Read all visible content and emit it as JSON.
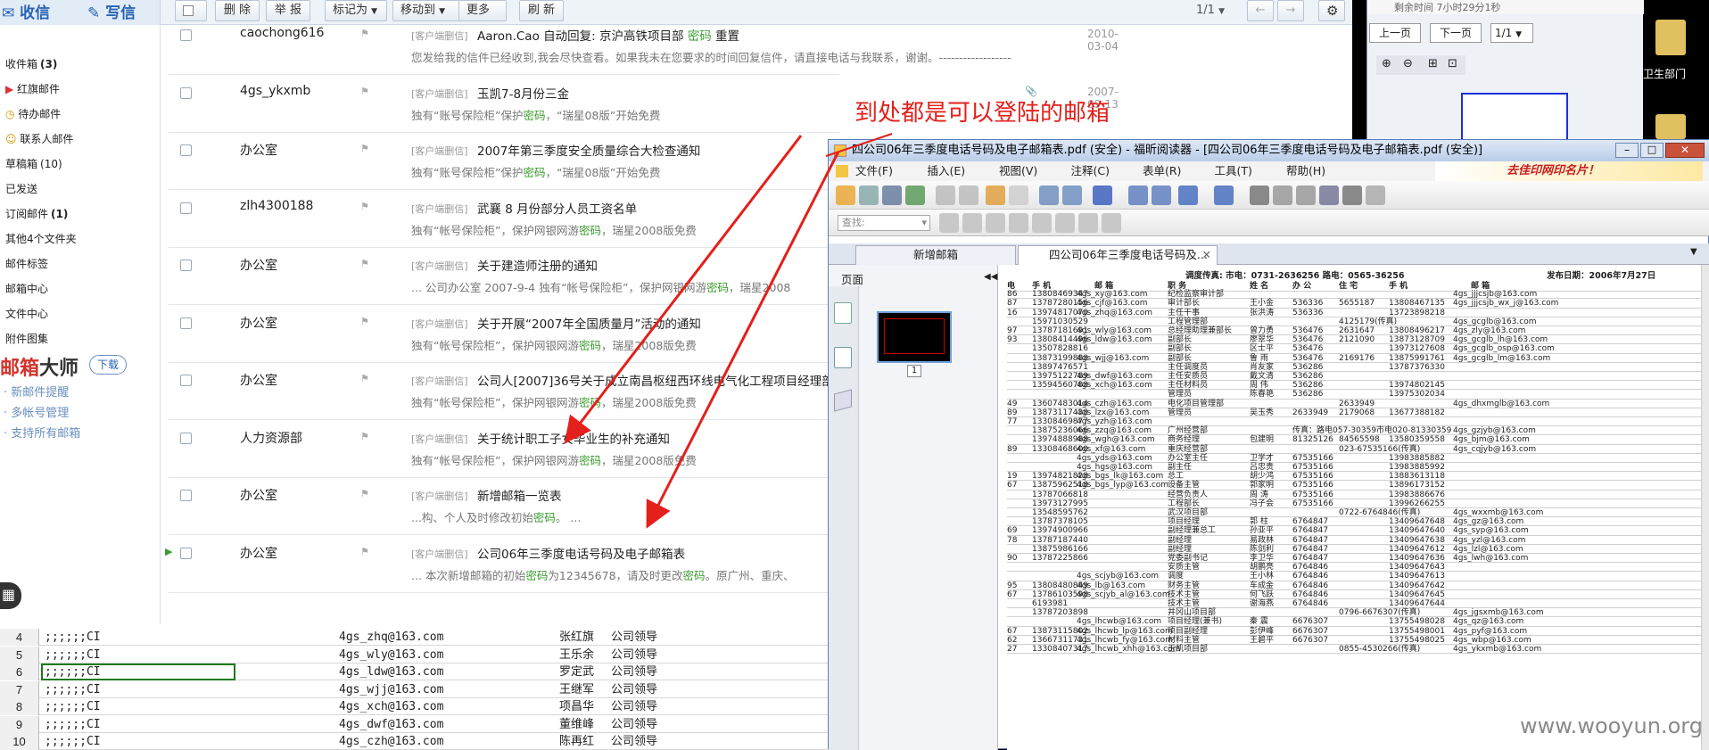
{
  "mail": {
    "top_buttons": {
      "inbox": "收信",
      "compose": "写信",
      "delete": "删 除",
      "report": "举 报",
      "mark": "标记为",
      "move": "移动到",
      "more": "更多",
      "refresh": "刷 新",
      "page": "1/1"
    },
    "sidebar": [
      {
        "label": "收件箱",
        "count": "(3)"
      },
      {
        "label": "红旗邮件",
        "count": ""
      },
      {
        "label": "待办邮件",
        "count": ""
      },
      {
        "label": "联系人邮件",
        "count": ""
      },
      {
        "label": "草稿箱",
        "count": "(10)"
      },
      {
        "label": "已发送",
        "count": ""
      },
      {
        "label": "订阅邮件",
        "count": "(1)"
      },
      {
        "label": "其他4个文件夹",
        "count": ""
      },
      {
        "label": "邮件标签",
        "count": ""
      },
      {
        "label": "邮箱中心",
        "count": ""
      },
      {
        "label": "文件中心",
        "count": ""
      },
      {
        "label": "附件图集",
        "count": ""
      }
    ],
    "promo": {
      "brand_a": "邮箱",
      "brand_b": "大师",
      "download": "下载",
      "items": [
        "新邮件提醒",
        "多帐号管理",
        "支持所有邮箱"
      ]
    },
    "tag": "[客户端删信]",
    "rows": [
      {
        "sender": "caochong616",
        "subject": "Aaron.Cao 自动回复: 京沪高铁项目部 密码 重置",
        "preview": "您发给我的信件已经收到,我会尽快查看。如果我未在您要求的时间回复信件，请直接电话与我联系，谢谢。------------------",
        "date": "2010-03-04"
      },
      {
        "sender": "4gs_ykxmb",
        "subject": "玉凯7-8月份三金",
        "preview": "独有“账号保险柜”保护密码，“瑞星08版”开始免费",
        "date": "2007-09-13"
      },
      {
        "sender": "办公室",
        "subject": "2007年第三季度安全质量综合大检查通知",
        "preview": "独有“账号保险柜”保护密码，“瑞星08版”开始免费",
        "date": ""
      },
      {
        "sender": "zlh4300188",
        "subject": "武襄 8 月份部分人员工资名单",
        "preview": "独有“帐号保险柜”，保护网银网游密码，瑞星2008版免费",
        "date": ""
      },
      {
        "sender": "办公室",
        "subject": "关于建造师注册的通知",
        "preview": "... 公司办公室 2007-9-4 独有“帐号保险柜”，保护网银网游密码，瑞星2008",
        "date": ""
      },
      {
        "sender": "办公室",
        "subject": "关于开展“2007年全国质量月”活动的通知",
        "preview": "独有“帐号保险柜”，保护网银网游密码，瑞星2008版免费",
        "date": ""
      },
      {
        "sender": "办公室",
        "subject": "公司人[2007]36号关于成立南昌枢纽西环线电气化工程项目经理部",
        "preview": "独有“帐号保险柜”，保护网银网游密码，瑞星2008版免费",
        "date": ""
      },
      {
        "sender": "人力资源部",
        "subject": "关于统计职工子女毕业生的补充通知",
        "preview": "独有“帐号保险柜”，保护网银网游密码，瑞星2008版免费",
        "date": ""
      },
      {
        "sender": "办公室",
        "subject": "新增邮箱一览表",
        "preview": "...构、个人及时修改初始密码。 ...",
        "date": ""
      },
      {
        "sender": "办公室",
        "subject": "公司06年三季度电话号码及电子邮箱表",
        "preview": "... 本次新增邮箱的初始密码为12345678，请及时更改密码。原广州、重庆、",
        "date": ""
      }
    ]
  },
  "annotation": "到处都是可以登陆的邮箱",
  "right_panel": {
    "timer": "剩余时间 7小时29分1秒",
    "prev": "上一页",
    "next": "下一页",
    "page": "1/1",
    "folder": "卫生部门"
  },
  "sheet": {
    "rows": [
      {
        "n": "4",
        "a": ";;;;;;CI",
        "b": "4gs_zhq@163.com",
        "c": "张红旗",
        "d": "公司领导"
      },
      {
        "n": "5",
        "a": ";;;;;;CI",
        "b": "4gs_wly@163.com",
        "c": "王乐余",
        "d": "公司领导"
      },
      {
        "n": "6",
        "a": ";;;;;;CI",
        "b": "4gs_ldw@163.com",
        "c": "罗定武",
        "d": "公司领导"
      },
      {
        "n": "7",
        "a": ";;;;;;CI",
        "b": "4gs_wjj@163.com",
        "c": "王继军",
        "d": "公司领导"
      },
      {
        "n": "8",
        "a": ";;;;;;CI",
        "b": "4gs_xch@163.com",
        "c": "项昌华",
        "d": "公司领导"
      },
      {
        "n": "9",
        "a": ";;;;;;CI",
        "b": "4gs_dwf@163.com",
        "c": "董维峰",
        "d": "公司领导"
      },
      {
        "n": "10",
        "a": ";;;;;;CI",
        "b": "4gs_czh@163.com",
        "c": "陈再红",
        "d": "公司领导"
      }
    ]
  },
  "pdf": {
    "title": "四公司06年三季度电话号码及电子邮箱表.pdf (安全) - 福昕阅读器 - [四公司06年三季度电话号码及电子邮箱表.pdf (安全)]",
    "menu": [
      "文件(F)",
      "插入(E)",
      "视图(V)",
      "注释(C)",
      "表单(R)",
      "工具(T)",
      "帮助(H)"
    ],
    "ad": "去佳印网印名片！",
    "search_placeholder": "查找:",
    "tabs": [
      "新增邮箱",
      "四公司06年三季度电话号码及..."
    ],
    "side_label": "页面",
    "thumb_page": "1",
    "doc_header": {
      "fax": "调度传真:   市电：0731-2636256     路电：0565-36256",
      "date": "发布日期：2006年7月27日"
    },
    "col_heads": [
      "电",
      "手 机",
      "邮 箱",
      "职 务",
      "姓 名",
      "办 公",
      "住 宅",
      "手 机",
      "邮 箱"
    ],
    "doc_lines": [
      {
        "a": "86",
        "b": "13808469347",
        "c": "4gs_xy@163.com",
        "d": "纪检监察审计部",
        "e": "",
        "f": "",
        "g": "",
        "h": "",
        "i": "4gs_jjjcsjb@163.com"
      },
      {
        "a": "87",
        "b": "13787280156",
        "c": "4gs_cjf@163.com",
        "d": "审计部长",
        "e": "王小金",
        "f": "536336",
        "g": "5655187",
        "h": "13808467135",
        "i": "4gs_jjjcsjb_wx_j@163.com"
      },
      {
        "a": "16",
        "b": "13974817070",
        "c": "4gs_zhq@163.com",
        "d": "主任干事",
        "e": "张洪涛",
        "f": "536336",
        "g": "",
        "h": "13723898218",
        "i": ""
      },
      {
        "a": "",
        "b": "15971030529",
        "c": "",
        "d": "工程管理部",
        "e": "",
        "f": "",
        "g": "4125179(传真)",
        "h": "",
        "i": "4gs_gcglb@163.com"
      },
      {
        "a": "97",
        "b": "13787181691",
        "c": "4gs_wly@163.com",
        "d": "总经理助理兼部长",
        "e": "曾力勇",
        "f": "536476",
        "g": "2631647",
        "h": "13808496217",
        "i": "4gs_zly@163.com"
      },
      {
        "a": "93",
        "b": "13808414496",
        "c": "4gs_ldw@163.com",
        "d": "副部长",
        "e": "廖翠华",
        "f": "536476",
        "g": "2121090",
        "h": "13873128709",
        "i": "4gs_gcglb_lh@163.com"
      },
      {
        "a": "",
        "b": "13507828816",
        "c": "",
        "d": "副部长",
        "e": "区士平",
        "f": "536476",
        "g": "",
        "h": "13973127608",
        "i": "4gs_gcglb_osp@163.com"
      },
      {
        "a": "",
        "b": "13873199888",
        "c": "4gs_wjj@163.com",
        "d": "副部长",
        "e": "鲁 雨",
        "f": "536476",
        "g": "2169176",
        "h": "13875991761",
        "i": "4gs_gcglb_lm@163.com"
      },
      {
        "a": "",
        "b": "13897476571",
        "c": "",
        "d": "主任调度员",
        "e": "肖友家",
        "f": "536286",
        "g": "",
        "h": "13787376330",
        "i": ""
      },
      {
        "a": "",
        "b": "13975122789",
        "c": "4gs_dwf@163.com",
        "d": "主任安质员",
        "e": "戴文清",
        "f": "536286",
        "g": "",
        "h": "",
        "i": ""
      },
      {
        "a": "",
        "b": "13594560788",
        "c": "4gs_xch@163.com",
        "d": "主任材料员",
        "e": "周 伟",
        "f": "536286",
        "g": "",
        "h": "13974802145",
        "i": ""
      },
      {
        "a": "",
        "b": "",
        "c": "",
        "d": "管理员",
        "e": "陈春艳",
        "f": "536286",
        "g": "",
        "h": "13975302034",
        "i": ""
      },
      {
        "a": "49",
        "b": "13607483014",
        "c": "4gs_czh@163.com",
        "d": "电化项目管理部",
        "e": "",
        "f": "",
        "g": "2633949",
        "h": "",
        "i": "4gs_dhxmglb@163.com"
      },
      {
        "a": "89",
        "b": "13873117438",
        "c": "4gs_lzx@163.com",
        "d": "管理员",
        "e": "吴玉秀",
        "f": "2633949",
        "g": "2179068",
        "h": "13677388182",
        "i": ""
      },
      {
        "a": "77",
        "b": "13308469877",
        "c": "4gs_yzh@163.com",
        "d": "",
        "e": "",
        "f": "",
        "g": "",
        "h": "",
        "i": ""
      },
      {
        "a": "",
        "b": "13875236066",
        "c": "4gs_zzq@163.com",
        "d": "广州经营部",
        "e": "",
        "f": "传真：路电057-30359市电020-81330359",
        "g": "",
        "h": "",
        "i": "4gs_gzjyb@163.com"
      },
      {
        "a": "",
        "b": "13974888988",
        "c": "4gs_wgh@163.com",
        "d": "商务经理",
        "e": "包建明",
        "f": "81325126",
        "g": "84565598",
        "h": "13580359558",
        "i": "4gs_bjm@163.com"
      },
      {
        "a": "89",
        "b": "13308468600",
        "c": "4gs_xf@163.com",
        "d": "重庆经营部",
        "e": "",
        "f": "",
        "g": "023-67535166(传真)",
        "h": "",
        "i": "4gs_cqjyb@163.com"
      },
      {
        "a": "",
        "b": "",
        "c": "4gs_yds@163.com",
        "d": "办公室主任",
        "e": "卫学才",
        "f": "67535166",
        "g": "",
        "h": "13983885882",
        "i": ""
      },
      {
        "a": "",
        "b": "",
        "c": "4gs_hgs@163.com",
        "d": "副主任",
        "e": "吕忠贵",
        "f": "67535166",
        "g": "",
        "h": "13983885992",
        "i": ""
      },
      {
        "a": "19",
        "b": "13974821828",
        "c": "4gs_bgs_lk@163.com",
        "d": "总工",
        "e": "胡少鸿",
        "f": "67535166",
        "g": "",
        "h": "13883613118",
        "i": ""
      },
      {
        "a": "67",
        "b": "13875962518",
        "c": "4gs_bgs_lyp@163.com",
        "d": "设备主管",
        "e": "郭家明",
        "f": "67535166",
        "g": "",
        "h": "13896173152",
        "i": ""
      },
      {
        "a": "",
        "b": "13787066818",
        "c": "",
        "d": "经营负责人",
        "e": "周 涛",
        "f": "67535166",
        "g": "",
        "h": "13983886676",
        "i": ""
      },
      {
        "a": "",
        "b": "13973127995",
        "c": "",
        "d": "工程部长",
        "e": "冯子会",
        "f": "67535166",
        "g": "",
        "h": "13996266255",
        "i": ""
      },
      {
        "a": "",
        "b": "13548595762",
        "c": "",
        "d": "武汉项目部",
        "e": "",
        "f": "",
        "g": "0722-6764846(传真)",
        "h": "",
        "i": "4gs_wxxmb@163.com"
      },
      {
        "a": "",
        "b": "13787378105",
        "c": "",
        "d": "项目经理",
        "e": "郭 柱",
        "f": "6764847",
        "g": "",
        "h": "13409647648",
        "i": "4gs_gz@163.com"
      },
      {
        "a": "69",
        "b": "13974900966",
        "c": "",
        "d": "副经理兼总工",
        "e": "孙亚平",
        "f": "6764847",
        "g": "",
        "h": "13409647640",
        "i": "4gs_syp@163.com"
      },
      {
        "a": "78",
        "b": "13787187440",
        "c": "",
        "d": "副经理",
        "e": "易政林",
        "f": "6764847",
        "g": "",
        "h": "13409647638",
        "i": "4gs_yzl@163.com"
      },
      {
        "a": "",
        "b": "13875986166",
        "c": "",
        "d": "副经理",
        "e": "陈剑利",
        "f": "6764847",
        "g": "",
        "h": "13409647612",
        "i": "4gs_lzl@163.com"
      },
      {
        "a": "90",
        "b": "13787225866",
        "c": "",
        "d": "党委副书记",
        "e": "李卫华",
        "f": "6764847",
        "g": "",
        "h": "13409647636",
        "i": "4gs_lwh@163.com"
      },
      {
        "a": "",
        "b": "",
        "c": "",
        "d": "安质主管",
        "e": "胡鹏亮",
        "f": "6764846",
        "g": "",
        "h": "13409647643",
        "i": ""
      },
      {
        "a": "",
        "b": "",
        "c": "4gs_scjyb@163.com",
        "d": "调度",
        "e": "王小林",
        "f": "6764846",
        "g": "",
        "h": "13409647613",
        "i": ""
      },
      {
        "a": "95",
        "b": "13808480849",
        "c": "4gs_lb@163.com",
        "d": "财务主管",
        "e": "车成金",
        "f": "6764846",
        "g": "",
        "h": "13409647642",
        "i": ""
      },
      {
        "a": "67",
        "b": "13786103598",
        "c": "4gs_scjyb_al@163.com",
        "d": "技术主管",
        "e": "何飞跃",
        "f": "6764846",
        "g": "",
        "h": "13409647645",
        "i": ""
      },
      {
        "a": "",
        "b": "6193981",
        "c": "",
        "d": "技术主管",
        "e": "谢海燕",
        "f": "6764846",
        "g": "",
        "h": "13409647644",
        "i": ""
      },
      {
        "a": "",
        "b": "13787203898",
        "c": "",
        "d": "井冈山项目部",
        "e": "",
        "f": "",
        "g": "0796-6676307(传真)",
        "h": "",
        "i": "4gs_jgsxmb@163.com"
      },
      {
        "a": "",
        "b": "",
        "c": "4gs_lhcwb@163.com",
        "d": "项目经理(兼书)",
        "e": "秦 震",
        "f": "6676307",
        "g": "",
        "h": "13755498028",
        "i": "4gs_qz@163.com"
      },
      {
        "a": "67",
        "b": "13873115802",
        "c": "4gs_lhcwb_lp@163.com",
        "d": "项目副经理",
        "e": "彭伊峰",
        "f": "6676307",
        "g": "",
        "h": "13755498001",
        "i": "4gs_pyf@163.com"
      },
      {
        "a": "62",
        "b": "13667311731",
        "c": "4gs_lhcwb_fy@163.com",
        "d": "材料主管",
        "e": "王碧平",
        "f": "6676307",
        "g": "",
        "h": "13755498025",
        "i": "4gs_wbp@163.com"
      },
      {
        "a": "27",
        "b": "13308407317",
        "c": "4gs_lhcwb_xhh@163.com",
        "d": "玉凯项目部",
        "e": "",
        "f": "",
        "g": "0855-4530266(传真)",
        "h": "",
        "i": "4gs_ykxmb@163.com"
      }
    ]
  },
  "watermark": "www.wooyun.org",
  "colors": {
    "link_green": "#3a9b2e",
    "annotation_red": "#e3201b",
    "brand_red": "#d0342c"
  }
}
